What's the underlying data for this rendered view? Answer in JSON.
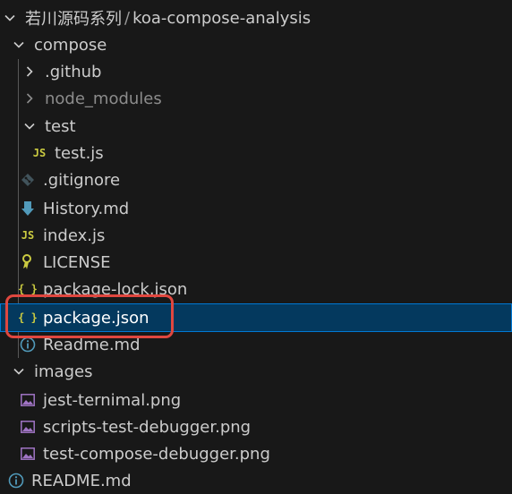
{
  "breadcrumb": {
    "root": "若川源码系列",
    "separator": "/",
    "project": "koa-compose-analysis"
  },
  "tree": {
    "compose": {
      "label": "compose"
    },
    "github": {
      "label": ".github"
    },
    "node_modules": {
      "label": "node_modules"
    },
    "test_folder": {
      "label": "test"
    },
    "test_js": {
      "label": "test.js",
      "badge": "JS"
    },
    "gitignore": {
      "label": ".gitignore"
    },
    "history": {
      "label": "History.md"
    },
    "index_js": {
      "label": "index.js",
      "badge": "JS"
    },
    "license": {
      "label": "LICENSE"
    },
    "package_lock": {
      "label": "package-lock.json",
      "badge": "{ }"
    },
    "package_json": {
      "label": "package.json",
      "badge": "{ }"
    },
    "readme_inner": {
      "label": "Readme.md"
    },
    "images": {
      "label": "images"
    },
    "jest_png": {
      "label": "jest-ternimal.png"
    },
    "scripts_png": {
      "label": "scripts-test-debugger.png"
    },
    "test_compose_png": {
      "label": "test-compose-debugger.png"
    },
    "readme_root": {
      "label": "README.md"
    }
  },
  "colors": {
    "background": "#181818",
    "selected_bg": "#04395e",
    "selected_border": "#0078d4",
    "annotation_red": "#e0473f",
    "js_yellow": "#cbcb41",
    "json_yellow": "#cbcb41",
    "md_blue": "#519aba",
    "image_purple": "#a074c4"
  }
}
